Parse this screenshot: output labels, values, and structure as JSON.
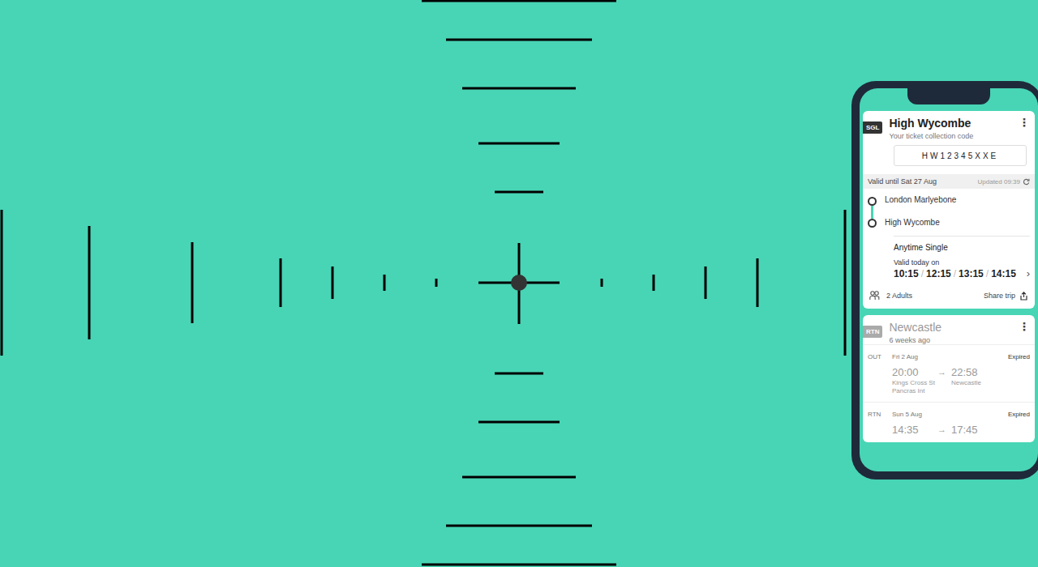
{
  "phone": {
    "active_ticket": {
      "badge": "SGL",
      "title": "High Wycombe",
      "subtitle": "Your ticket collection code",
      "code": "HW12345XXE",
      "menu": "⋮",
      "valid_until": "Valid until Sat 27 Aug",
      "updated": "Updated 09:39",
      "stops": [
        "London Marlyebone",
        "High Wycombe"
      ],
      "ticket_type": "Anytime Single",
      "valid_label": "Valid today on",
      "times": [
        "10:15",
        "12:15",
        "13:15",
        "14:15"
      ],
      "separator": "/",
      "chevron": "›",
      "passengers": "2 Adults",
      "share": "Share trip"
    },
    "past_ticket": {
      "badge": "RTN",
      "title": "Newcastle",
      "subtitle": "6 weeks ago",
      "menu": "⋮",
      "expired": true,
      "legs": [
        {
          "label": "OUT",
          "date": "Fri 2 Aug",
          "status": "Expired",
          "depart": "20:00",
          "arrow": "→",
          "arrive": "22:58",
          "from": "Kings Cross St Pancras Int",
          "to": "Newcastle"
        },
        {
          "label": "RTN",
          "date": "Sun 5 Aug",
          "status": "Expired",
          "depart": "14:35",
          "arrow": "→",
          "arrive": "17:45"
        }
      ]
    }
  }
}
